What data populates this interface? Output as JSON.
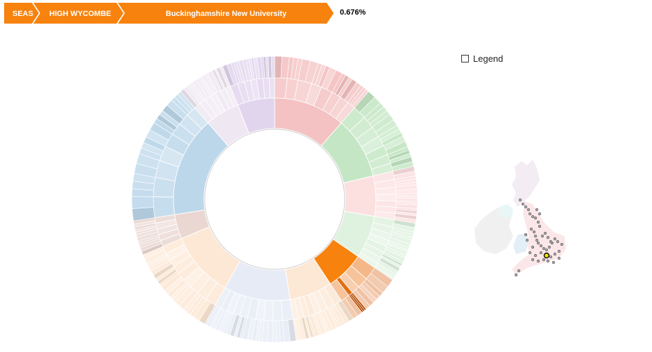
{
  "breadcrumb": {
    "items": [
      {
        "label": "SEAS"
      },
      {
        "label": "HIGH WYCOMBE"
      },
      {
        "label": "Buckinghamshire New University"
      }
    ],
    "color": "#f7820d"
  },
  "percentage": "0.676%",
  "legend": {
    "label": "Legend",
    "checked": false
  },
  "chart_data": {
    "type": "sunburst",
    "note_units": "share of whole (fraction)",
    "inner_ring": [
      {
        "value": 0.125,
        "color": "#f4c2c2",
        "children": [
          0.018,
          0.016,
          0.02,
          0.015,
          0.017,
          0.014,
          0.013,
          0.012
        ]
      },
      {
        "value": 0.108,
        "color": "#c4e6c4",
        "children": [
          0.02,
          0.018,
          0.016,
          0.015,
          0.014,
          0.013,
          0.012
        ]
      },
      {
        "value": 0.07,
        "color": "#fce0e0",
        "children": [
          0.012,
          0.011,
          0.01,
          0.01,
          0.009,
          0.009,
          0.009
        ]
      },
      {
        "value": 0.075,
        "color": "#dff2df",
        "children": [
          0.011,
          0.01,
          0.01,
          0.009,
          0.009,
          0.009,
          0.009,
          0.008
        ]
      },
      {
        "value": 0.0676,
        "color": "#f7820d",
        "children": [
          0.02,
          0.016,
          0.012,
          0.0066,
          0.013
        ]
      },
      {
        "value": 0.075,
        "color": "#fce8d5",
        "children": [
          0.012,
          0.011,
          0.01,
          0.009,
          0.009,
          0.008,
          0.008,
          0.008
        ]
      },
      {
        "value": 0.1155,
        "color": "#e6ebf5",
        "children": [
          0.015,
          0.014,
          0.013,
          0.012,
          0.012,
          0.011,
          0.01,
          0.01,
          0.009,
          0.0095
        ]
      },
      {
        "value": 0.115,
        "color": "#fde8d5",
        "children": [
          0.016,
          0.015,
          0.014,
          0.013,
          0.012,
          0.012,
          0.011,
          0.011,
          0.011
        ]
      },
      {
        "value": 0.043,
        "color": "#ead7d2",
        "children": [
          0.009,
          0.009,
          0.008,
          0.009,
          0.008
        ]
      },
      {
        "value": 0.175,
        "color": "#bcd7ea",
        "children": [
          0.03,
          0.028,
          0.025,
          0.022,
          0.02,
          0.018,
          0.017,
          0.015
        ]
      },
      {
        "value": 0.06,
        "color": "#efe7f2",
        "children": [
          0.01,
          0.009,
          0.009,
          0.008,
          0.008,
          0.008,
          0.008
        ]
      },
      {
        "value": 0.065,
        "color": "#e1d5ee",
        "children": [
          0.011,
          0.01,
          0.009,
          0.009,
          0.009,
          0.009,
          0.008
        ]
      }
    ]
  },
  "map": {
    "land_color": "#f0f0f0",
    "scotland_color": "#f3ecf3",
    "england_color": "#fbe7ea",
    "wales_color": "#e4eef6",
    "ni_color": "#e8f6f6",
    "marker_color": "#999999",
    "highlight_color": "#f7e000"
  }
}
